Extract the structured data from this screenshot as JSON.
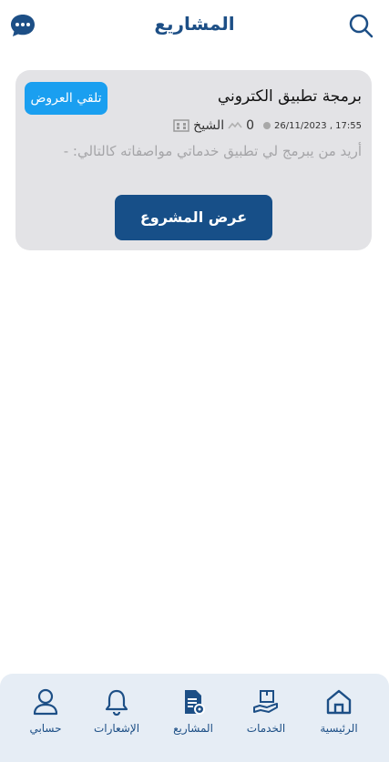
{
  "header": {
    "title": "المشاريع",
    "search_icon": "search-icon",
    "chat_icon": "chat-bubble-icon"
  },
  "project": {
    "title": "برمجة تطبيق الكتروني",
    "badge": "تلقي العروض",
    "location": "الشيخ",
    "views": "0",
    "datetime": "26/11/2023 , 17:55",
    "description": "أريد من يبرمج لي تطبيق خدماتي مواصفاته كالتالي: -",
    "view_button": "عرض المشروع"
  },
  "bottom_nav": {
    "items": [
      {
        "label": "الرئيسية",
        "icon": "home-icon"
      },
      {
        "label": "الخدمات",
        "icon": "services-icon"
      },
      {
        "label": "المشاريع",
        "icon": "projects-icon"
      },
      {
        "label": "الإشعارات",
        "icon": "bell-icon"
      },
      {
        "label": "حسابي",
        "icon": "user-icon"
      }
    ]
  },
  "colors": {
    "primary": "#1d4f86",
    "button": "#174f88",
    "badge": "#1a9ff0",
    "card": "#e3e3e6",
    "nav_bg": "#e6edf5"
  }
}
